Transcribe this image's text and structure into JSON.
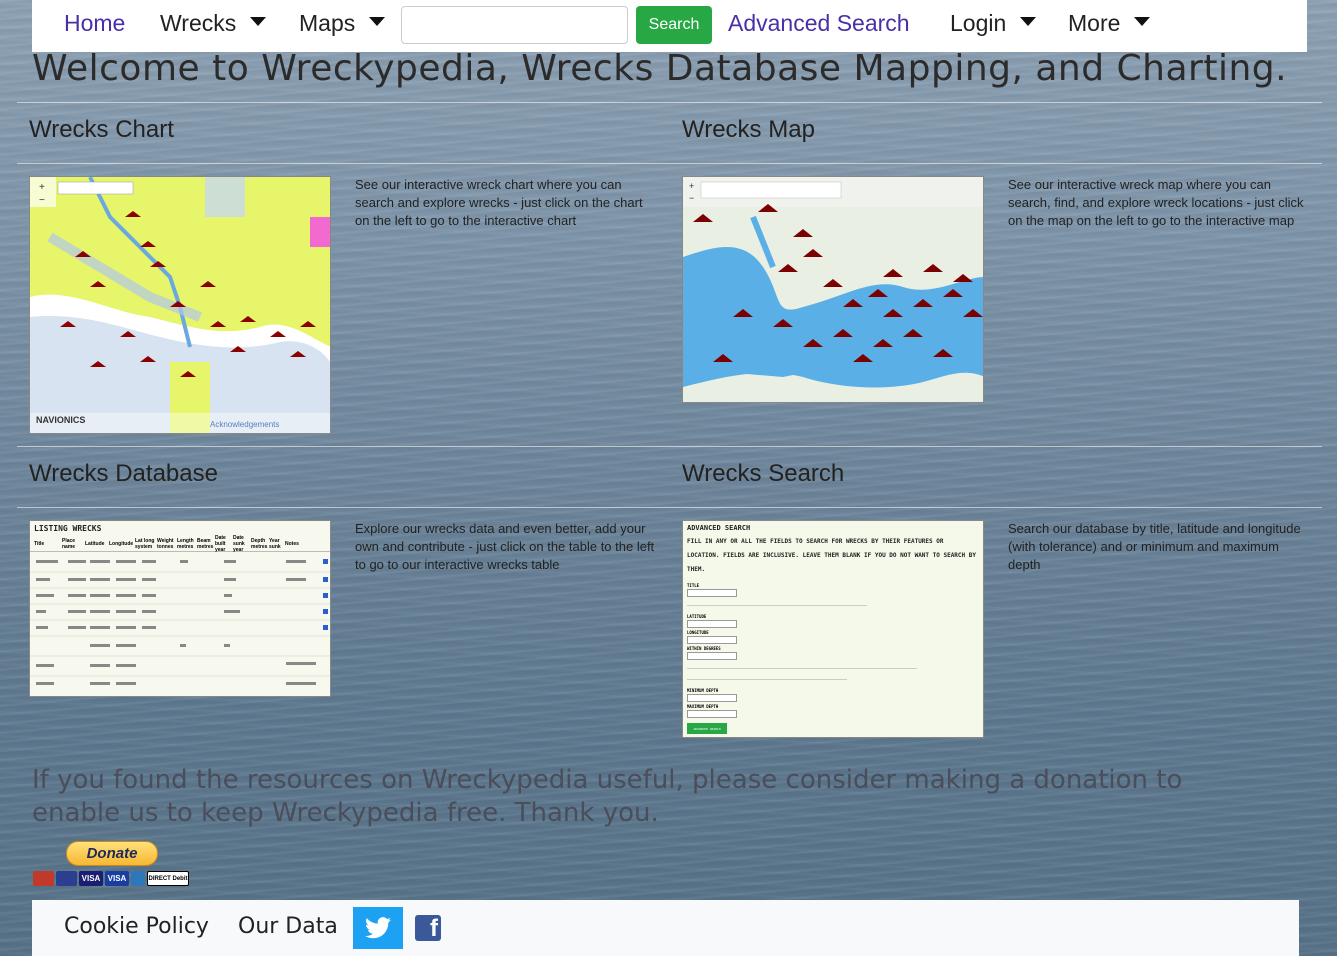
{
  "nav": {
    "home": "Home",
    "wrecks": "Wrecks",
    "maps": "Maps",
    "search_placeholder": "",
    "search_button": "Search",
    "advanced_search": "Advanced Search",
    "login": "Login",
    "more": "More"
  },
  "page_title": "Welcome to Wreckypedia, Wrecks Database Mapping, and Charting.",
  "sections": {
    "chart": {
      "title": "Wrecks Chart",
      "text": "See our interactive wreck chart where you can search and explore wrecks - just click on the chart on the left to go to the interactive chart",
      "brand": "NAVIONICS",
      "credit": "Acknowledgements"
    },
    "map": {
      "title": "Wrecks Map",
      "text": "See our interactive wreck map where you can search, find, and explore wreck locations - just click on the map on the left to go to the interactive map"
    },
    "database": {
      "title": "Wrecks Database",
      "text": "Explore our wrecks data and even better, add your own and contribute - just click on the table to the left to go to our interactive wrecks table",
      "table_heading": "LISTING WRECKS",
      "columns": [
        "Title",
        "Place name",
        "Latitude",
        "Longitude",
        "Lat long system",
        "Weight tonnes",
        "Length metres",
        "Beam metres",
        "Date built year",
        "Date sunk year",
        "Depth metres",
        "Year sunk",
        "Notes"
      ]
    },
    "search": {
      "title": "Wrecks Search",
      "text": "Search our database by title, latitude and longitude (with tolerance) and or minimum and maximum depth",
      "form_heading": "ADVANCED SEARCH",
      "form_intro": "FILL IN ANY OR ALL THE FIELDS TO SEARCH FOR WRECKS BY THEIR FEATURES OR LOCATION. FIELDS ARE INCLUSIVE. LEAVE THEM BLANK IF YOU DO NOT WANT TO SEARCH BY THEM.",
      "fields": [
        "TITLE",
        "LATITUDE",
        "LONGITUDE",
        "WITHIN DEGREES",
        "MINIMUM DEPTH",
        "MAXIMUM DEPTH"
      ],
      "button": "ADVANCED SEARCH"
    }
  },
  "donation": {
    "text": "If you found the resources on Wreckypedia useful, please consider making a donation to enable us to keep Wreckypedia free. Thank you.",
    "button": "Donate",
    "cards": [
      "",
      "",
      "VISA",
      "VISA",
      "",
      "DIRECT Debit"
    ]
  },
  "footer": {
    "cookie": "Cookie Policy",
    "data": "Our Data"
  },
  "colors": {
    "nav_link": "#4b2fa8",
    "search_button": "#28a745",
    "twitter": "#1da1f2",
    "facebook": "#3b5998"
  }
}
